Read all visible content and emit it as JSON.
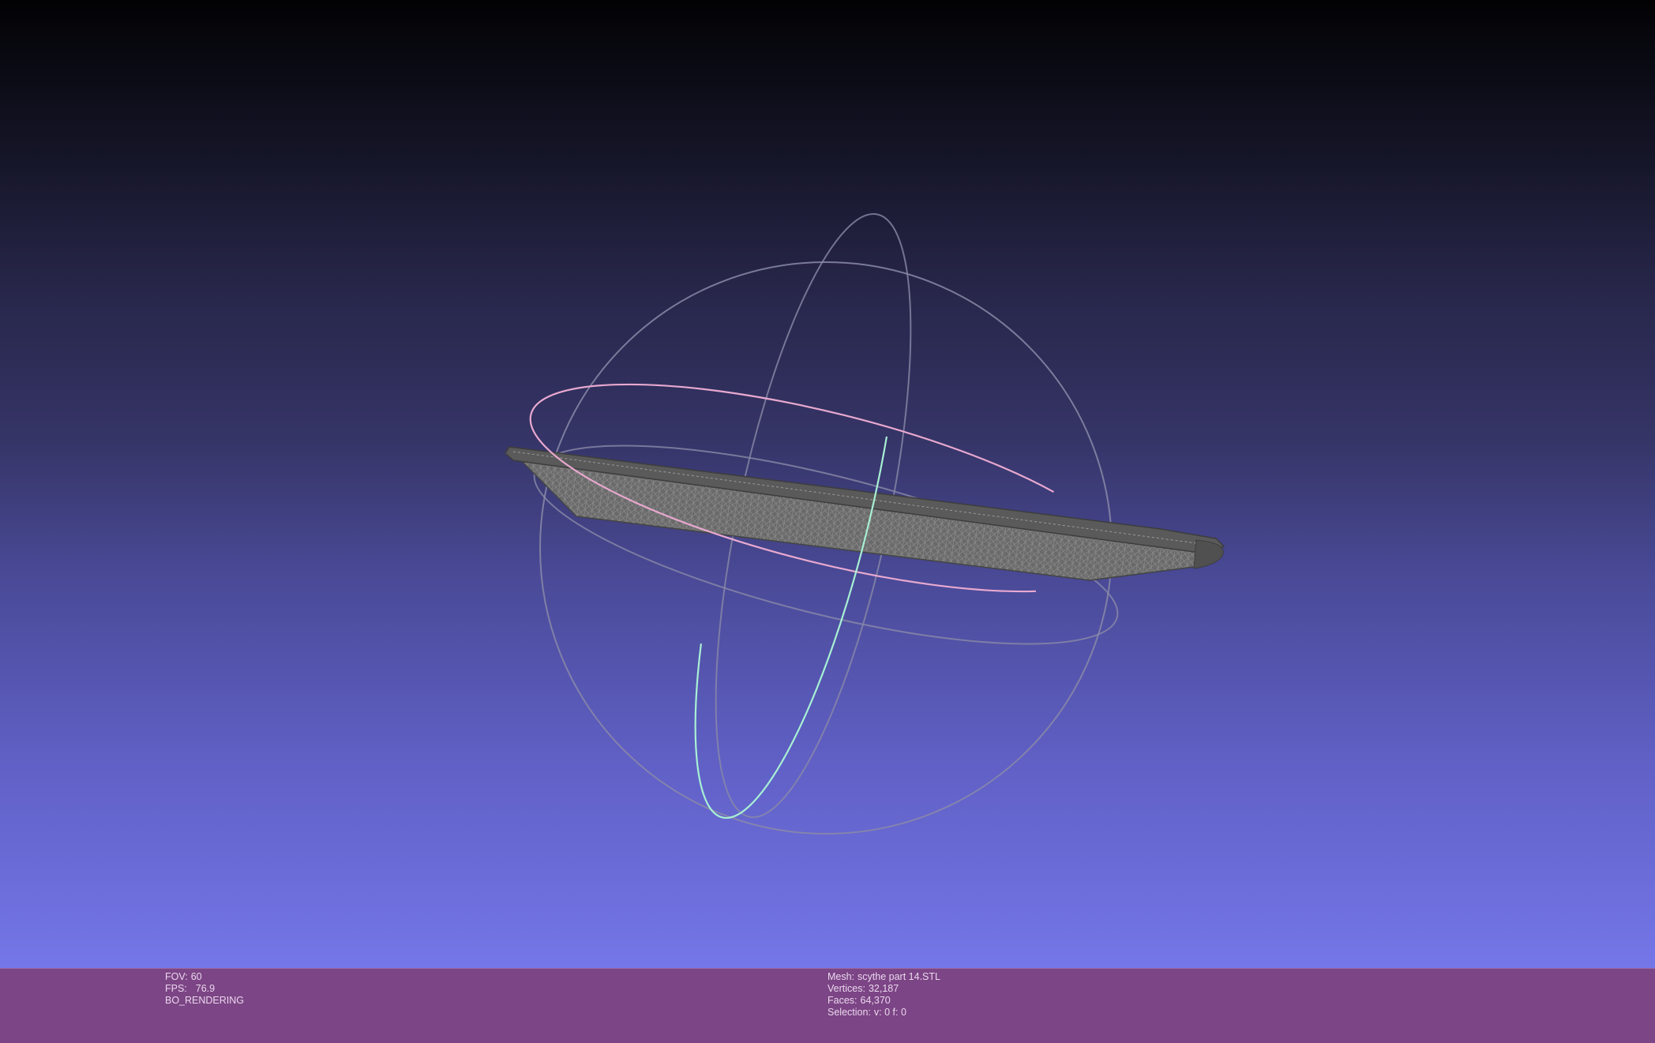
{
  "viewer": {
    "background_top": "#020204",
    "background_bottom": "#7576e8",
    "infobar_color": "#7c4585",
    "trackball_colors": {
      "horizontal_ring": "#e8a9cf",
      "vertical_ring": "#a8f0d4",
      "outer_rings": "#8a8aa8"
    },
    "mesh_color": "#5a5a5a"
  },
  "info_left": {
    "fov_label": "FOV:",
    "fov_value": "60",
    "fps_label": "FPS:",
    "fps_value": "76.9",
    "render_mode": "BO_RENDERING"
  },
  "info_right": {
    "mesh_label": "Mesh:",
    "mesh_value": "scythe part 14.STL",
    "vertices_label": "Vertices:",
    "vertices_value": "32,187",
    "faces_label": "Faces:",
    "faces_value": "64,370",
    "selection_label": "Selection:",
    "selection_value": "v: 0 f: 0"
  }
}
